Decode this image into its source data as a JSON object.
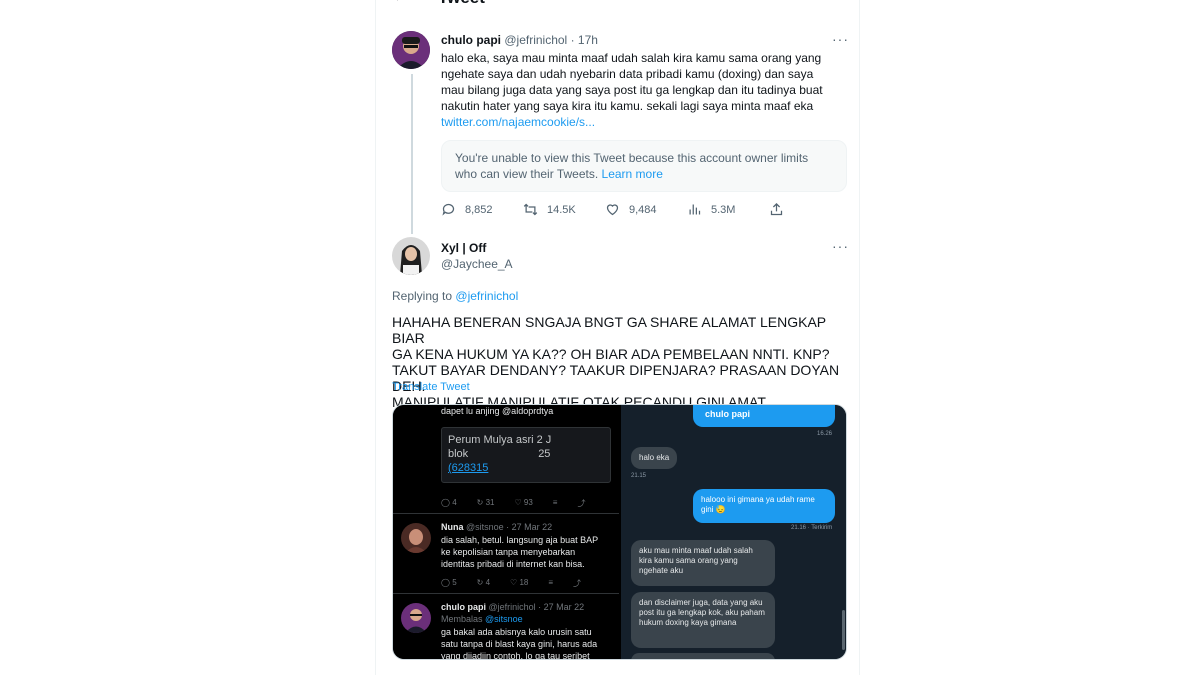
{
  "header": {
    "back_icon": "arrow-left-icon",
    "title": "Tweet"
  },
  "main_tweet": {
    "name": "chulo papi",
    "handle": "@jefrinichol",
    "separator": "·",
    "time": "17h",
    "more": "···",
    "lines": [
      "halo eka, saya mau minta maaf udah salah kira kamu sama orang yang",
      "ngehate saya dan udah nyebarin data pribadi kamu (doxing) dan saya",
      "mau bilang juga data yang saya post itu ga lengkap dan itu tadinya buat",
      "nakutin hater yang saya kira itu kamu. sekali lagi saya minta maaf eka"
    ],
    "link": "twitter.com/najaemcookie/s...",
    "restricted_text_1": "You're unable to view this Tweet because this account owner limits",
    "restricted_text_2": "who can view their Tweets.",
    "learn_more": "Learn more",
    "stats": {
      "replies": "8,852",
      "retweets": "14.5K",
      "likes": "9,484",
      "views": "5.3M"
    }
  },
  "reply_tweet": {
    "name": "Xyl | Off",
    "handle": "@Jaychee_A",
    "more": "···",
    "replying_prefix": "Replying to",
    "replying_to": "@jefrinichol",
    "lines": [
      "HAHAHA BENERAN SNGAJA BNGT GA SHARE ALAMAT LENGKAP BIAR",
      "GA KENA HUKUM YA KA?? OH BIAR ADA PEMBELAAN NNTI. KNP?",
      "TAKUT BAYAR DENDANY? TAAKUR DIPENJARA? PRASAAN DOYAN DEH.",
      "MANIPULATIF MANIPULATIF OTAK PECANDU GINI AMAT."
    ],
    "translate": "Translate Tweet"
  },
  "media_left": {
    "top_line": "dapet lu anjing @aldoprdtya",
    "addr_line1": "Perum Mulya asri 2 J",
    "addr_line2a": "blok",
    "addr_line2b": "25",
    "addr_line3": "(628315",
    "post1_stats": {
      "replies": "4",
      "retweets": "31",
      "likes": "93"
    },
    "nuna_name": "Nuna",
    "nuna_meta": "@sitsnoe · 27 Mar 22",
    "nuna_lines": [
      "dia salah, betul. langsung aja buat BAP",
      "ke kepolisian tanpa menyebarkan",
      "identitas pribadi di internet kan bisa."
    ],
    "post2_stats": {
      "replies": "5",
      "retweets": "4",
      "likes": "18"
    },
    "chulo_name": "chulo papi",
    "chulo_meta": "@jefrinichol · 27 Mar 22",
    "membalas": "Membalas",
    "membalas_to": "@sitsnoe",
    "chulo_lines": [
      "ga bakal ada abisnya kalo urusin satu",
      "satu tanpa di blast kaya gini, harus ada",
      "yang dijadiin contoh. lo ga tau seribet"
    ]
  },
  "media_right": {
    "chat_header": "chulo papi",
    "header_time": "16.26",
    "msg1": "halo eka",
    "msg1_time": "21.15",
    "msg2": "halooo ini gimana ya udah rame gini 😓",
    "msg2_time": "21.16 · Terkirim",
    "msg3": "aku mau minta maaf udah salah kira kamu sama orang yang ngehate aku",
    "msg4": "dan disclaimer juga, data yang aku post itu ga lengkap kok, aku paham hukum doxing kaya gimana"
  },
  "colors": {
    "accent": "#1d9bf0",
    "muted": "#536471",
    "text": "#0f1419",
    "dark_bg": "#15202b"
  }
}
